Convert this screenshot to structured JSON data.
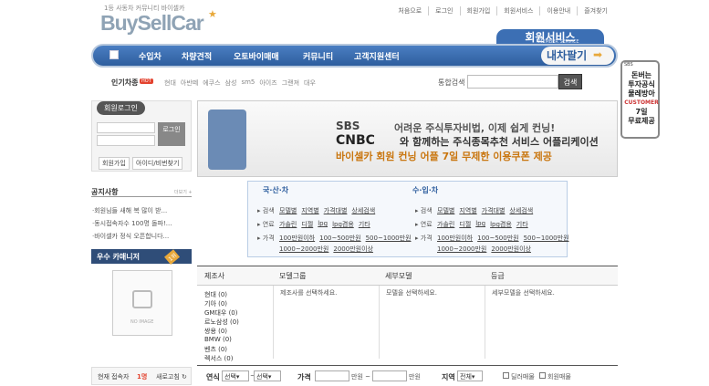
{
  "header": {
    "tagline": "1등 사동차 커뮤니티 바이셀카",
    "logo": "BuySellCar",
    "top_links": [
      "처음으로",
      "로그인",
      "회원가입",
      "회원서비스",
      "이용안내",
      "즐겨찾기"
    ],
    "member_service": "회원서비스",
    "member_service_sub": "MEMBER SERVICE"
  },
  "nav": {
    "items": [
      "수입차",
      "차량견적",
      "오토바이매매",
      "커뮤니티",
      "고객지원센터"
    ],
    "sell_button": "내차팔기"
  },
  "popular": {
    "label": "인기차종",
    "hot": "HOT",
    "brands": [
      "현대",
      "아반떼",
      "에쿠스",
      "삼성",
      "sm5",
      "아이즈",
      "그랜져",
      "대우"
    ]
  },
  "search": {
    "label": "통합검색",
    "button": "검색"
  },
  "phone_widget": {
    "sbs": "SBS",
    "lines": [
      "돈버는",
      "투자공식",
      "물레방아",
      "CUSTOMER",
      "7일",
      "무료제공"
    ]
  },
  "login": {
    "title": "회원로그인",
    "login_button": "로그인",
    "join": "회원가입",
    "find": "아이디/비번찾기"
  },
  "banner": {
    "sbs": "SBS",
    "cnbc": "CNBC",
    "line1": "어려운 주식투자비법, 이제 쉽게 컨닝!",
    "line2": "와 함께하는 주식종목추천 서비스 어플리케이션",
    "line3": "바이셀카 회원 컨닝 어플 7일 무제한 이용쿠폰 제공"
  },
  "notice": {
    "title": "공지사항",
    "more": "더보기 +",
    "items": [
      "·회원님들 새해 복 많이 받...",
      "·동시접속자수 100명 돌파!...",
      "·바이셀카 정식 오픈합니다..."
    ]
  },
  "best": {
    "title": "우수 카매니저",
    "badge": "1위",
    "no_image": "NO IMAGE"
  },
  "visitors": {
    "label": "현재 접속자",
    "count": "1명",
    "refresh": "새로고침 ↻"
  },
  "categories": {
    "domestic": {
      "title": "국·산·차",
      "search_label": "검색",
      "search": [
        "모델별",
        "지역별",
        "가격대별",
        "상세검색"
      ],
      "fuel_label": "연료",
      "fuel": [
        "가솔린",
        "디젤",
        "lpg",
        "lpg겸용",
        "기타"
      ],
      "price_label": "가격",
      "price": [
        "100만원이하",
        "100~500만원",
        "500~1000만원",
        "1000~2000만원",
        "2000만원이상"
      ]
    },
    "import": {
      "title": "수·입·차",
      "search_label": "검색",
      "search": [
        "모델별",
        "지역별",
        "가격대별",
        "상세검색"
      ],
      "fuel_label": "연료",
      "fuel": [
        "가솔린",
        "디젤",
        "lpg",
        "lpg겸용",
        "기타"
      ],
      "price_label": "가격",
      "price": [
        "100만원이하",
        "100~500만원",
        "500~1000만원",
        "1000~2000만원",
        "2000만원이상"
      ]
    }
  },
  "grid": {
    "headers": [
      "제조사",
      "모델그룹",
      "세부모델",
      "등급"
    ],
    "model_group_hint": "제조사를 선택하세요.",
    "detail_hint": "모델을 선택하세요.",
    "grade_hint": "세부모델을 선택하세요.",
    "makers": [
      "현대 (0)",
      "기아 (0)",
      "GM대우 (0)",
      "르노삼성 (0)",
      "쌍용 (0)",
      "BMW (0)",
      "벤츠 (0)",
      "렉서스 (0)"
    ]
  },
  "filter": {
    "year_label": "연식",
    "year_from": "선택",
    "year_to": "선택",
    "price_label": "가격",
    "unit1": "만원 ~",
    "unit2": "만원",
    "region_label": "지역",
    "region": "전체",
    "dealer": "딜러매물",
    "member": "회원매물"
  }
}
